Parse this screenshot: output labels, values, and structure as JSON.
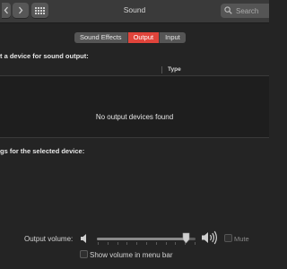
{
  "window": {
    "title": "Sound"
  },
  "toolbar": {
    "back_icon": "chevron-left-icon",
    "forward_icon": "chevron-right-icon",
    "grid_icon": "grid-icon",
    "search_placeholder": "Search"
  },
  "tabs": [
    {
      "label": "Sound Effects",
      "active": false
    },
    {
      "label": "Output",
      "active": true
    },
    {
      "label": "Input",
      "active": false
    }
  ],
  "output": {
    "section_label": "t a device for sound output:",
    "columns": {
      "type": "Type"
    },
    "empty_message": "No output devices found",
    "settings_label": "gs for the selected device:"
  },
  "volume": {
    "label": "Output volume:",
    "level": 0.9,
    "mute_label": "Mute",
    "mute_checked": false,
    "show_in_menubar_label": "Show volume in menu bar",
    "show_in_menubar_checked": false
  },
  "colors": {
    "accent": "#e0443b",
    "background": "#242424"
  }
}
